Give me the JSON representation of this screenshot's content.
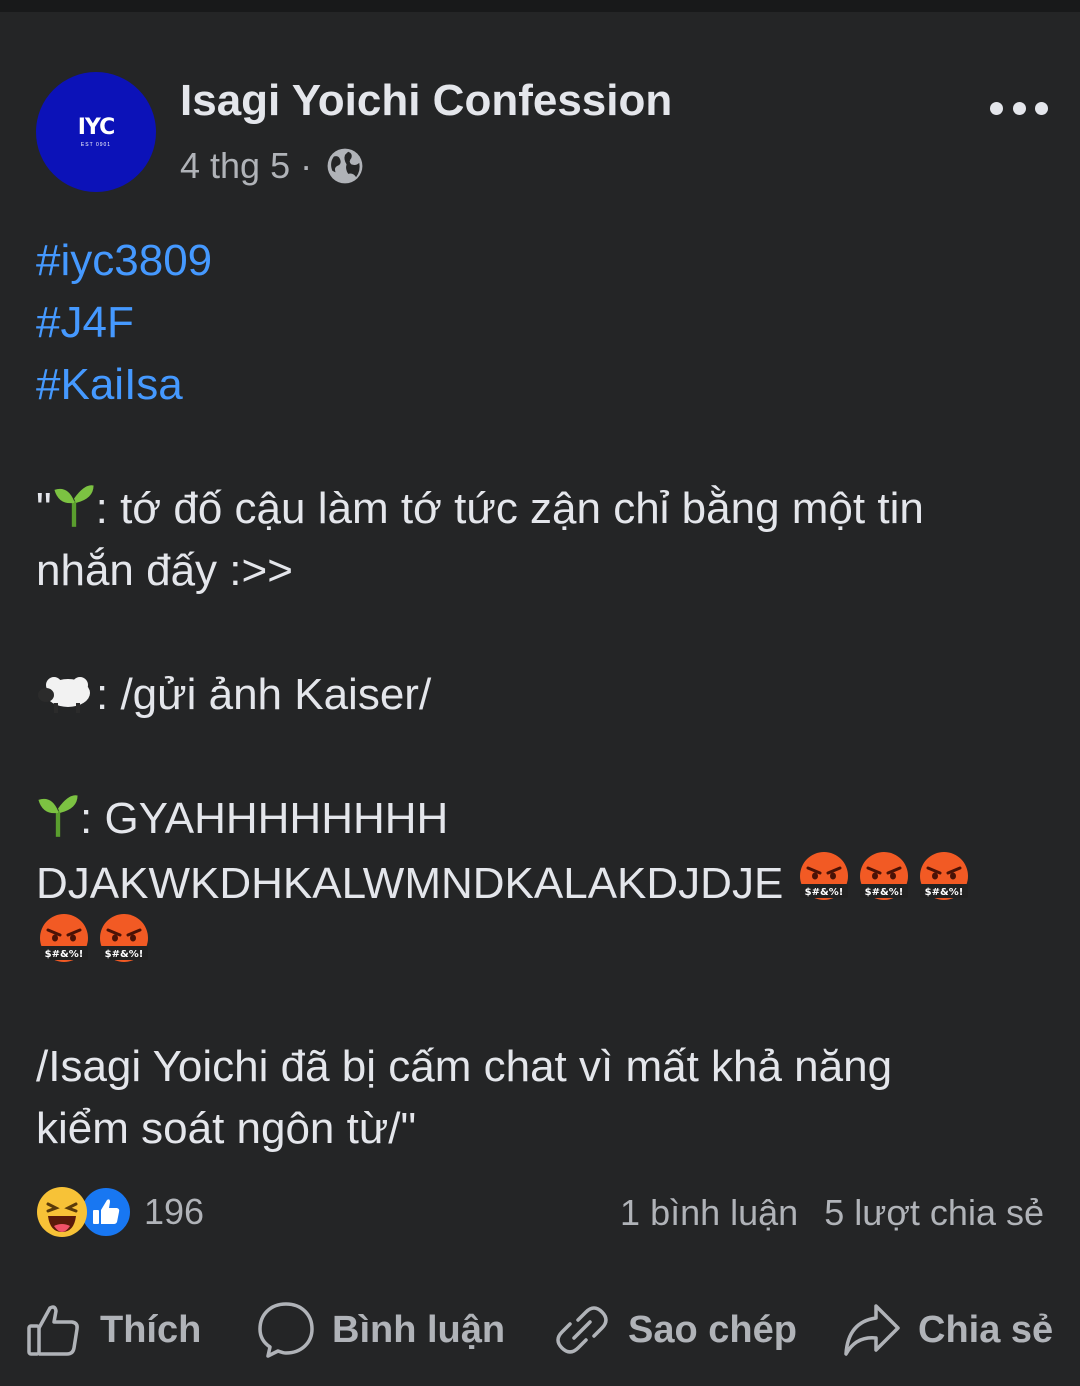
{
  "post": {
    "page_name": "Isagi Yoichi Confession",
    "avatar": {
      "logo_text": "IYC",
      "logo_sub": "EST 0901",
      "color": "#0c12b8"
    },
    "date": "4 thg 5",
    "separator": "·",
    "privacy_icon": "globe-icon",
    "more_icon": "more-options-icon",
    "hashtags": [
      "#iyc3809",
      "#J4F",
      "#KaiIsa"
    ],
    "body": {
      "line1_prefix": "\"",
      "line1_text": ": tớ đố cậu làm tớ tức zận chỉ bằng một tin",
      "line2": "nhắn đấy :>>",
      "line3_text": ": /gửi ảnh Kaiser/",
      "line4_text": ": GYAHHHHHHHH",
      "line5_text": "DJAKWKDHKALWMNDKALAKDJDJE",
      "line6": "/Isagi Yoichi đã bị cấm chat vì mất khả năng",
      "line7": "kiểm soát ngôn từ/\""
    },
    "emoji": {
      "sprout": "seedling-emoji",
      "sheep": "sheep-emoji",
      "angry": "angry-cursing-emoji",
      "angry_caption": "$#&%!"
    },
    "reactions": {
      "icons": [
        "haha-reaction-icon",
        "like-reaction-icon"
      ],
      "count": "196"
    },
    "stats": {
      "comments": "1 bình luận",
      "shares": "5 lượt chia sẻ"
    },
    "actions": [
      {
        "label": "Thích",
        "icon": "thumbs-up-icon"
      },
      {
        "label": "Bình luận",
        "icon": "comment-bubble-icon"
      },
      {
        "label": "Sao chép",
        "icon": "link-icon"
      },
      {
        "label": "Chia sẻ",
        "icon": "share-arrow-icon"
      }
    ],
    "colors": {
      "background": "#242526",
      "text": "#e4e6eb",
      "secondary_text": "#b0b3b8",
      "hashtag": "#4599ff",
      "like_blue": "#1877f2"
    }
  }
}
